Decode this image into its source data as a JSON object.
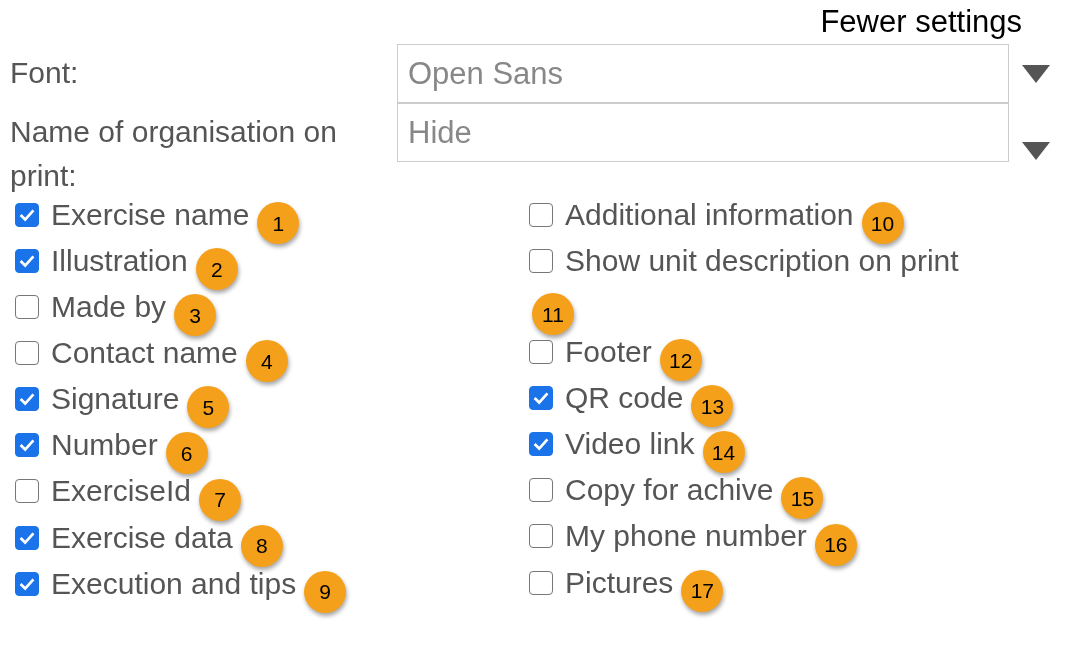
{
  "header_link": "Fewer settings",
  "fields": [
    {
      "label": "Font:",
      "value": "Open Sans"
    },
    {
      "label": "Name of organisation on print:",
      "value": "Hide"
    }
  ],
  "columns": [
    [
      {
        "label": "Exercise name",
        "checked": true,
        "badge": "1"
      },
      {
        "label": "Illustration",
        "checked": true,
        "badge": "2"
      },
      {
        "label": "Made by",
        "checked": false,
        "badge": "3"
      },
      {
        "label": "Contact name",
        "checked": false,
        "badge": "4"
      },
      {
        "label": "Signature",
        "checked": true,
        "badge": "5"
      },
      {
        "label": "Number",
        "checked": true,
        "badge": "6"
      },
      {
        "label": "ExerciseId",
        "checked": false,
        "badge": "7"
      },
      {
        "label": "Exercise data",
        "checked": true,
        "badge": "8"
      },
      {
        "label": "Execution and tips",
        "checked": true,
        "badge": "9"
      }
    ],
    [
      {
        "label": "Additional information",
        "checked": false,
        "badge": "10"
      },
      {
        "label": "Show unit description on print",
        "checked": false,
        "badge": "11"
      },
      {
        "label": "Footer",
        "checked": false,
        "badge": "12"
      },
      {
        "label": "QR code",
        "checked": true,
        "badge": "13"
      },
      {
        "label": "Video link",
        "checked": true,
        "badge": "14"
      },
      {
        "label": "Copy for achive",
        "checked": false,
        "badge": "15"
      },
      {
        "label": "My phone number",
        "checked": false,
        "badge": "16"
      },
      {
        "label": "Pictures",
        "checked": false,
        "badge": "17"
      }
    ]
  ]
}
